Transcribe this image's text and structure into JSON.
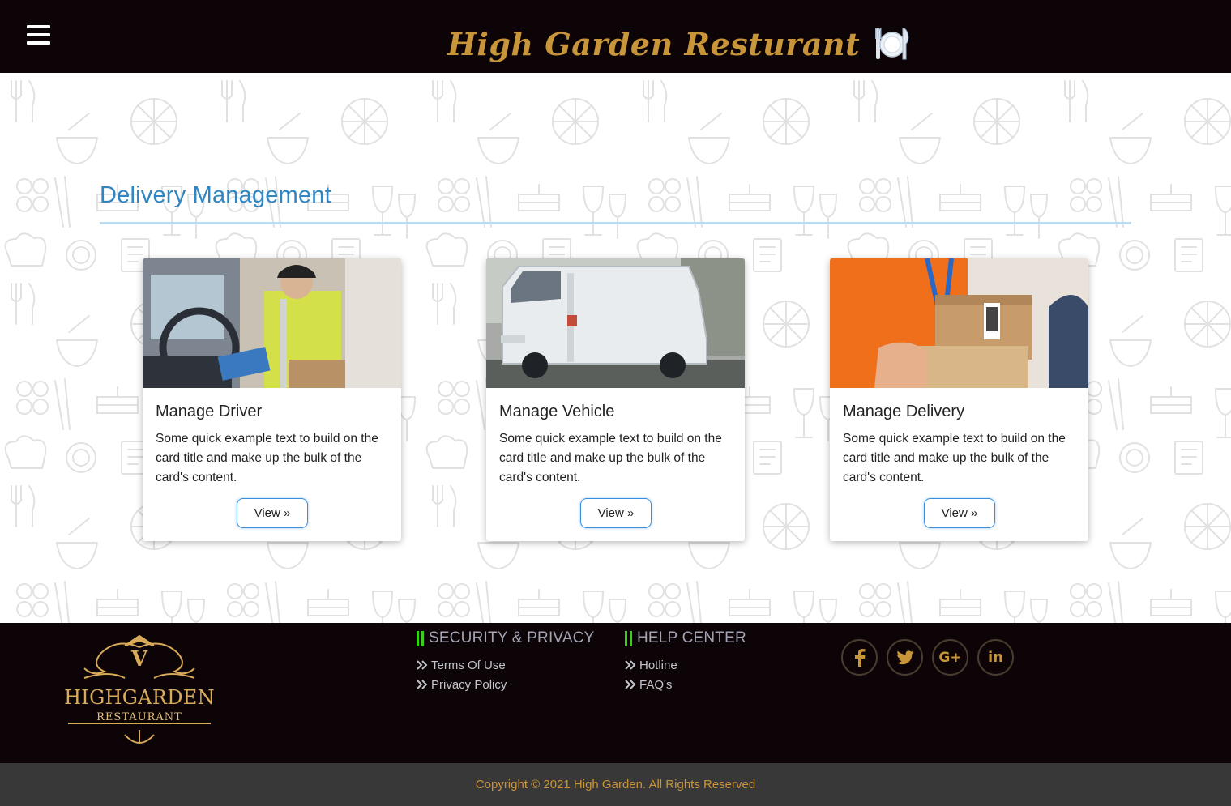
{
  "header": {
    "brand_title": "High Garden Resturant",
    "menu_icon": "hamburger-menu-icon",
    "brand_icon": "plate-cutlery-icon"
  },
  "main": {
    "section_title": "Delivery Management",
    "cards": [
      {
        "title": "Manage Driver",
        "text": "Some quick example text to build on the card title and make up the bulk of the card's content.",
        "button": "View »",
        "image": "delivery-driver-photo"
      },
      {
        "title": "Manage Vehicle",
        "text": "Some quick example text to build on the card title and make up the bulk of the card's content.",
        "button": "View »",
        "image": "delivery-van-photo"
      },
      {
        "title": "Manage Delivery",
        "text": "Some quick example text to build on the card title and make up the bulk of the card's content.",
        "button": "View »",
        "image": "parcel-handover-photo"
      }
    ]
  },
  "footer": {
    "logo": {
      "line1": "HIGHGARDEN",
      "line2": "RESTAURANT",
      "monogram": "V"
    },
    "columns": [
      {
        "title": "SECURITY & PRIVACY",
        "links": [
          "Terms Of Use",
          "Privacy Policy"
        ]
      },
      {
        "title": "HELP CENTER",
        "links": [
          "Hotline",
          "FAQ's"
        ]
      }
    ],
    "social": [
      {
        "icon": "facebook-icon",
        "glyph": "f"
      },
      {
        "icon": "twitter-icon",
        "glyph": "🐦"
      },
      {
        "icon": "google-plus-icon",
        "glyph": "G+"
      },
      {
        "icon": "linkedin-icon",
        "glyph": "in"
      }
    ],
    "copyright": "Copyright © 2021 High Garden. All Rights Reserved"
  },
  "colors": {
    "header_bg": "#0c0406",
    "brand_gold": "#c9953a",
    "section_blue": "#2f86c3",
    "accent_green": "#3ad11a",
    "copyright_bg": "#383838"
  }
}
